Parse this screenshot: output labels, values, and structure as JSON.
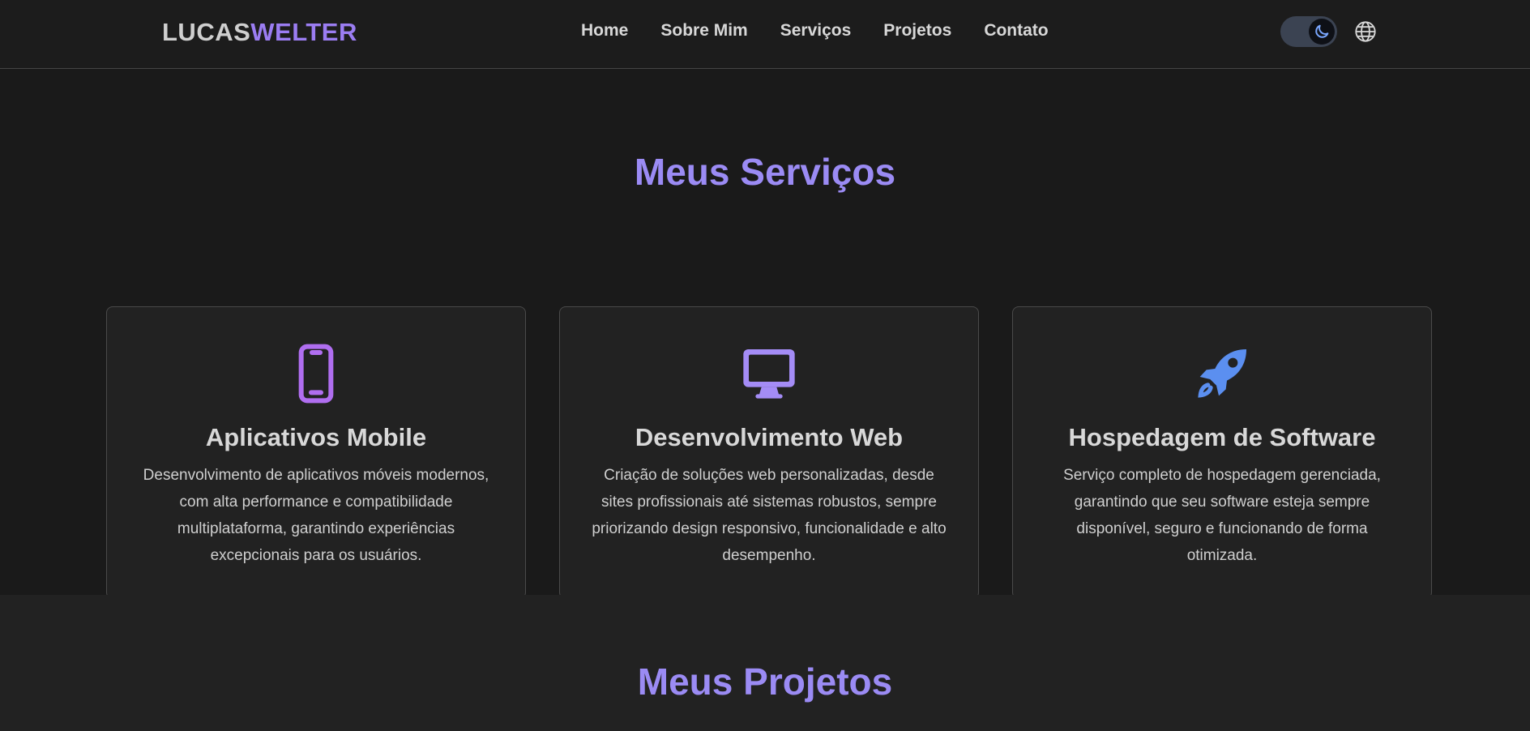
{
  "header": {
    "logo_part1": "LUCAS",
    "logo_part2": "WELTER",
    "nav": [
      "Home",
      "Sobre Mim",
      "Serviços",
      "Projetos",
      "Contato"
    ],
    "theme_toggle_icon": "moon-icon",
    "language_icon": "globe-icon"
  },
  "services": {
    "title": "Meus Serviços",
    "cards": [
      {
        "icon": "smartphone-icon",
        "title": "Aplicativos Mobile",
        "description": "Desenvolvimento de aplicativos móveis modernos, com alta performance e compatibilidade multiplataforma, garantindo experiências excepcionais para os usuários."
      },
      {
        "icon": "monitor-icon",
        "title": "Desenvolvimento Web",
        "description": "Criação de soluções web personalizadas, desde sites profissionais até sistemas robustos, sempre priorizando design responsivo, funcionalidade e alto desempenho."
      },
      {
        "icon": "rocket-icon",
        "title": "Hospedagem de Software",
        "description": "Serviço completo de hospedagem gerenciada, garantindo que seu software esteja sempre disponível, seguro e funcionando de forma otimizada."
      }
    ]
  },
  "projects": {
    "title": "Meus Projetos"
  },
  "colors": {
    "accent": "#9b8bf4",
    "background": "#1a1a1a",
    "card": "#222222"
  }
}
